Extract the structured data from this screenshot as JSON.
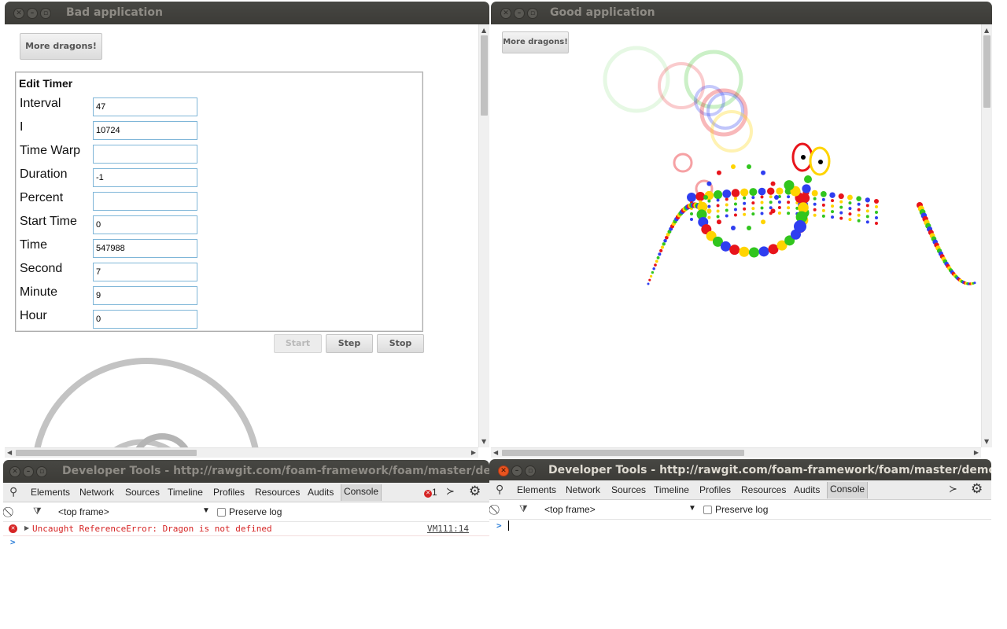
{
  "bad_window": {
    "title": "Bad application",
    "more_dragons_label": "More dragons!",
    "legend": "Edit Timer",
    "fields": [
      {
        "label": "Interval",
        "value": "47"
      },
      {
        "label": "I",
        "value": "10724"
      },
      {
        "label": "Time Warp",
        "value": ""
      },
      {
        "label": "Duration",
        "value": "-1"
      },
      {
        "label": "Percent",
        "value": ""
      },
      {
        "label": "Start Time",
        "value": "0"
      },
      {
        "label": "Time",
        "value": "547988"
      },
      {
        "label": "Second",
        "value": "7"
      },
      {
        "label": "Minute",
        "value": "9"
      },
      {
        "label": "Hour",
        "value": "0"
      }
    ],
    "buttons": {
      "start": "Start",
      "step": "Step",
      "stop": "Stop"
    },
    "drawing_color": "#c3c3c3"
  },
  "good_window": {
    "title": "Good application",
    "more_dragons_label": "More dragons!",
    "dragon_colors": [
      "#2f3ef0",
      "#e8141b",
      "#ffd400",
      "#31c51e"
    ]
  },
  "devtools_left": {
    "title": "Developer Tools - http://rawgit.com/foam-framework/foam/master/dem",
    "tabs": [
      "Elements",
      "Network",
      "Sources",
      "Timeline",
      "Profiles",
      "Resources",
      "Audits",
      "Console"
    ],
    "selected_tab": "Console",
    "error_count": "1",
    "frame_select": "<top frame>",
    "preserve_log_label": "Preserve log",
    "error_message": "Uncaught ReferenceError: Dragon is not defined",
    "error_source": "VM111:14",
    "prompt": ">"
  },
  "devtools_right": {
    "title": "Developer Tools - http://rawgit.com/foam-framework/foam/master/demos/",
    "tabs": [
      "Elements",
      "Network",
      "Sources",
      "Timeline",
      "Profiles",
      "Resources",
      "Audits",
      "Console"
    ],
    "selected_tab": "Console",
    "frame_select": "<top frame>",
    "preserve_log_label": "Preserve log",
    "prompt": ">"
  },
  "colors": {
    "error": "#d62525",
    "titlebar": "#3c3b37",
    "close_active": "#e9541f",
    "prompt": "#2d7fd8"
  }
}
